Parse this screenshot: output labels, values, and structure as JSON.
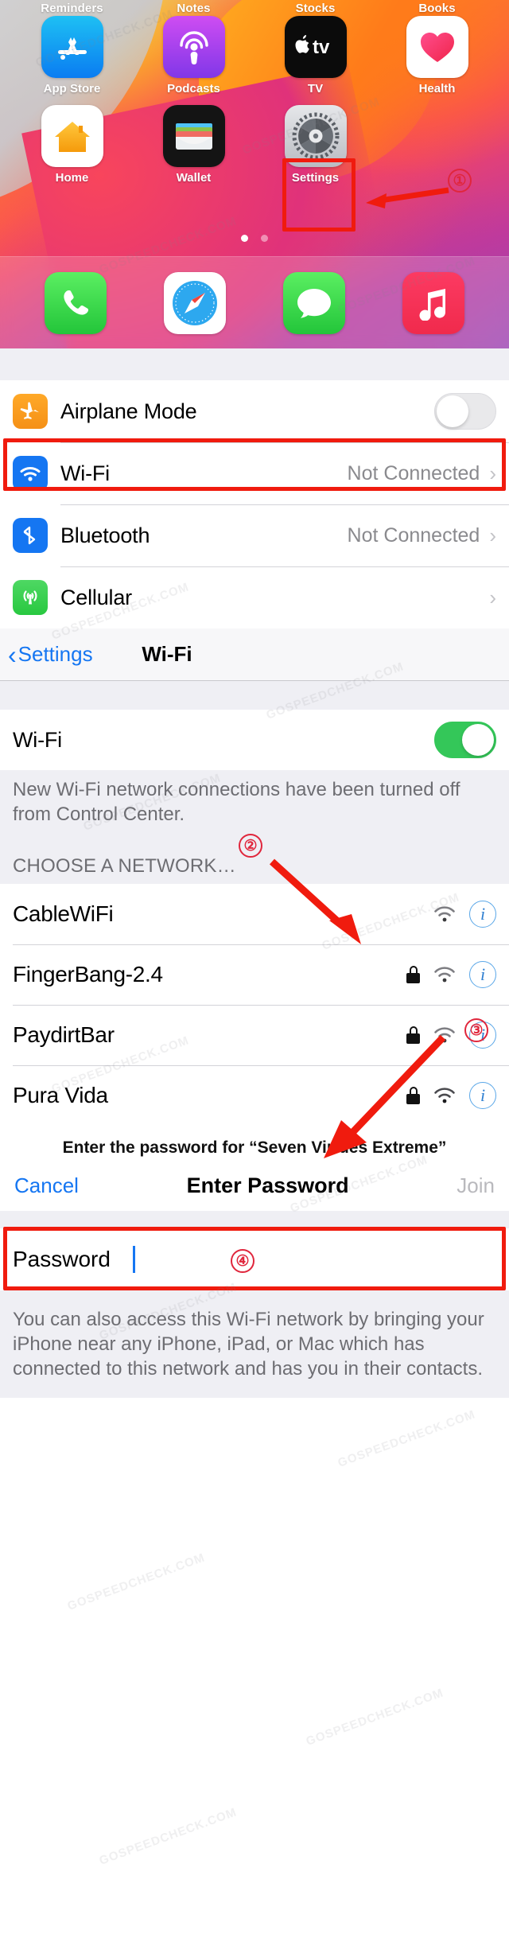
{
  "homescreen": {
    "top_labels": [
      "Reminders",
      "Notes",
      "Stocks",
      "Books"
    ],
    "row1": [
      {
        "label": "App Store",
        "icon": "app-store-icon"
      },
      {
        "label": "Podcasts",
        "icon": "podcasts-icon"
      },
      {
        "label": "TV",
        "icon": "tv-icon"
      },
      {
        "label": "Health",
        "icon": "health-icon"
      }
    ],
    "row2": [
      {
        "label": "Home",
        "icon": "home-icon"
      },
      {
        "label": "Wallet",
        "icon": "wallet-icon"
      },
      {
        "label": "Settings",
        "icon": "settings-icon"
      }
    ],
    "dock": [
      {
        "label": "Phone",
        "icon": "phone-icon"
      },
      {
        "label": "Safari",
        "icon": "safari-icon"
      },
      {
        "label": "Messages",
        "icon": "messages-icon"
      },
      {
        "label": "Music",
        "icon": "music-icon"
      }
    ],
    "page_dots": 2,
    "active_dot": 0
  },
  "settings_list": {
    "rows": [
      {
        "label": "Airplane Mode",
        "icon": "airplane-icon",
        "control": "toggle",
        "toggle_on": false,
        "value": ""
      },
      {
        "label": "Wi-Fi",
        "icon": "wifi-icon",
        "control": "value",
        "value": "Not Connected"
      },
      {
        "label": "Bluetooth",
        "icon": "bluetooth-icon",
        "control": "value",
        "value": "Not Connected"
      },
      {
        "label": "Cellular",
        "icon": "cellular-icon",
        "control": "value",
        "value": ""
      }
    ],
    "chevron": "›"
  },
  "wifi_page": {
    "back_label": "Settings",
    "back_caret": "‹",
    "title": "Wi-Fi",
    "toggle_row_label": "Wi-Fi",
    "toggle_on": true,
    "footnote": "New Wi-Fi network connections have been turned off from Control Center.",
    "choose_header": "CHOOSE A NETWORK…",
    "networks": [
      {
        "name": "CableWiFi",
        "locked": false,
        "signal": "wifi-icon",
        "info": "info-icon"
      },
      {
        "name": "FingerBang-2.4",
        "locked": true,
        "signal": "wifi-icon",
        "info": "info-icon"
      },
      {
        "name": "PaydirtBar",
        "locked": true,
        "signal": "wifi-icon",
        "info": "info-icon"
      },
      {
        "name": "Pura Vida",
        "locked": true,
        "signal": "wifi-icon",
        "info": "info-icon"
      }
    ]
  },
  "password_dialog": {
    "prompt": "Enter the password for “Seven Virtues Extreme”",
    "cancel_label": "Cancel",
    "title": "Enter Password",
    "join_label": "Join",
    "field_placeholder": "Password",
    "field_value": "",
    "footer": "You can also access this Wi-Fi network by bringing your iPhone near any iPhone, iPad, or Mac which has connected to this network and has you in their contacts."
  },
  "annotations": {
    "markers": [
      "①",
      "②",
      "③",
      "④"
    ],
    "highlight_color": "#f01b0e",
    "marker_color": "#e0263c"
  },
  "watermark": {
    "text": "GOSPEEDCHECK.COM"
  }
}
